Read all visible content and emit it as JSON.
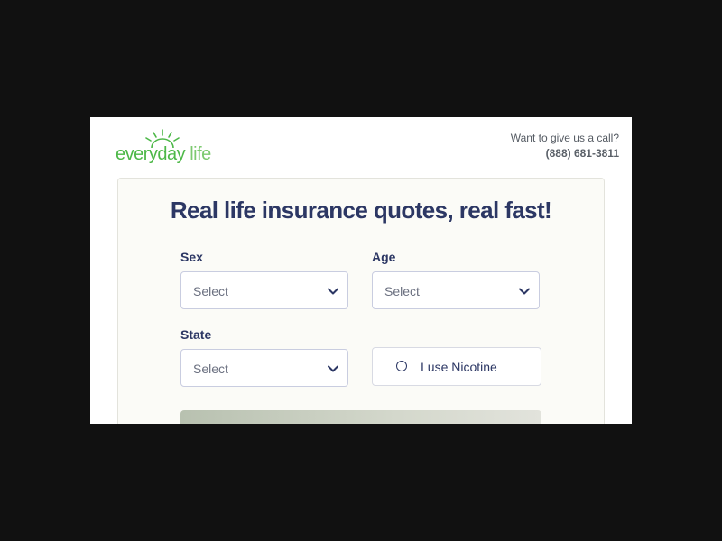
{
  "header": {
    "logo": {
      "brand_main": "everyday",
      "brand_sub": "life",
      "icon": "sun-icon",
      "color": "#4db848"
    },
    "call": {
      "prompt": "Want to give us a call?",
      "phone": "(888) 681-3811"
    }
  },
  "form": {
    "headline": "Real life insurance quotes, real fast!",
    "sex": {
      "label": "Sex",
      "value": "Select"
    },
    "age": {
      "label": "Age",
      "value": "Select"
    },
    "state": {
      "label": "State",
      "value": "Select"
    },
    "nicotine": {
      "label": "I use Nicotine",
      "checked": false
    }
  },
  "colors": {
    "background": "#111111",
    "heading": "#2c3764",
    "accent": "#4db848"
  }
}
